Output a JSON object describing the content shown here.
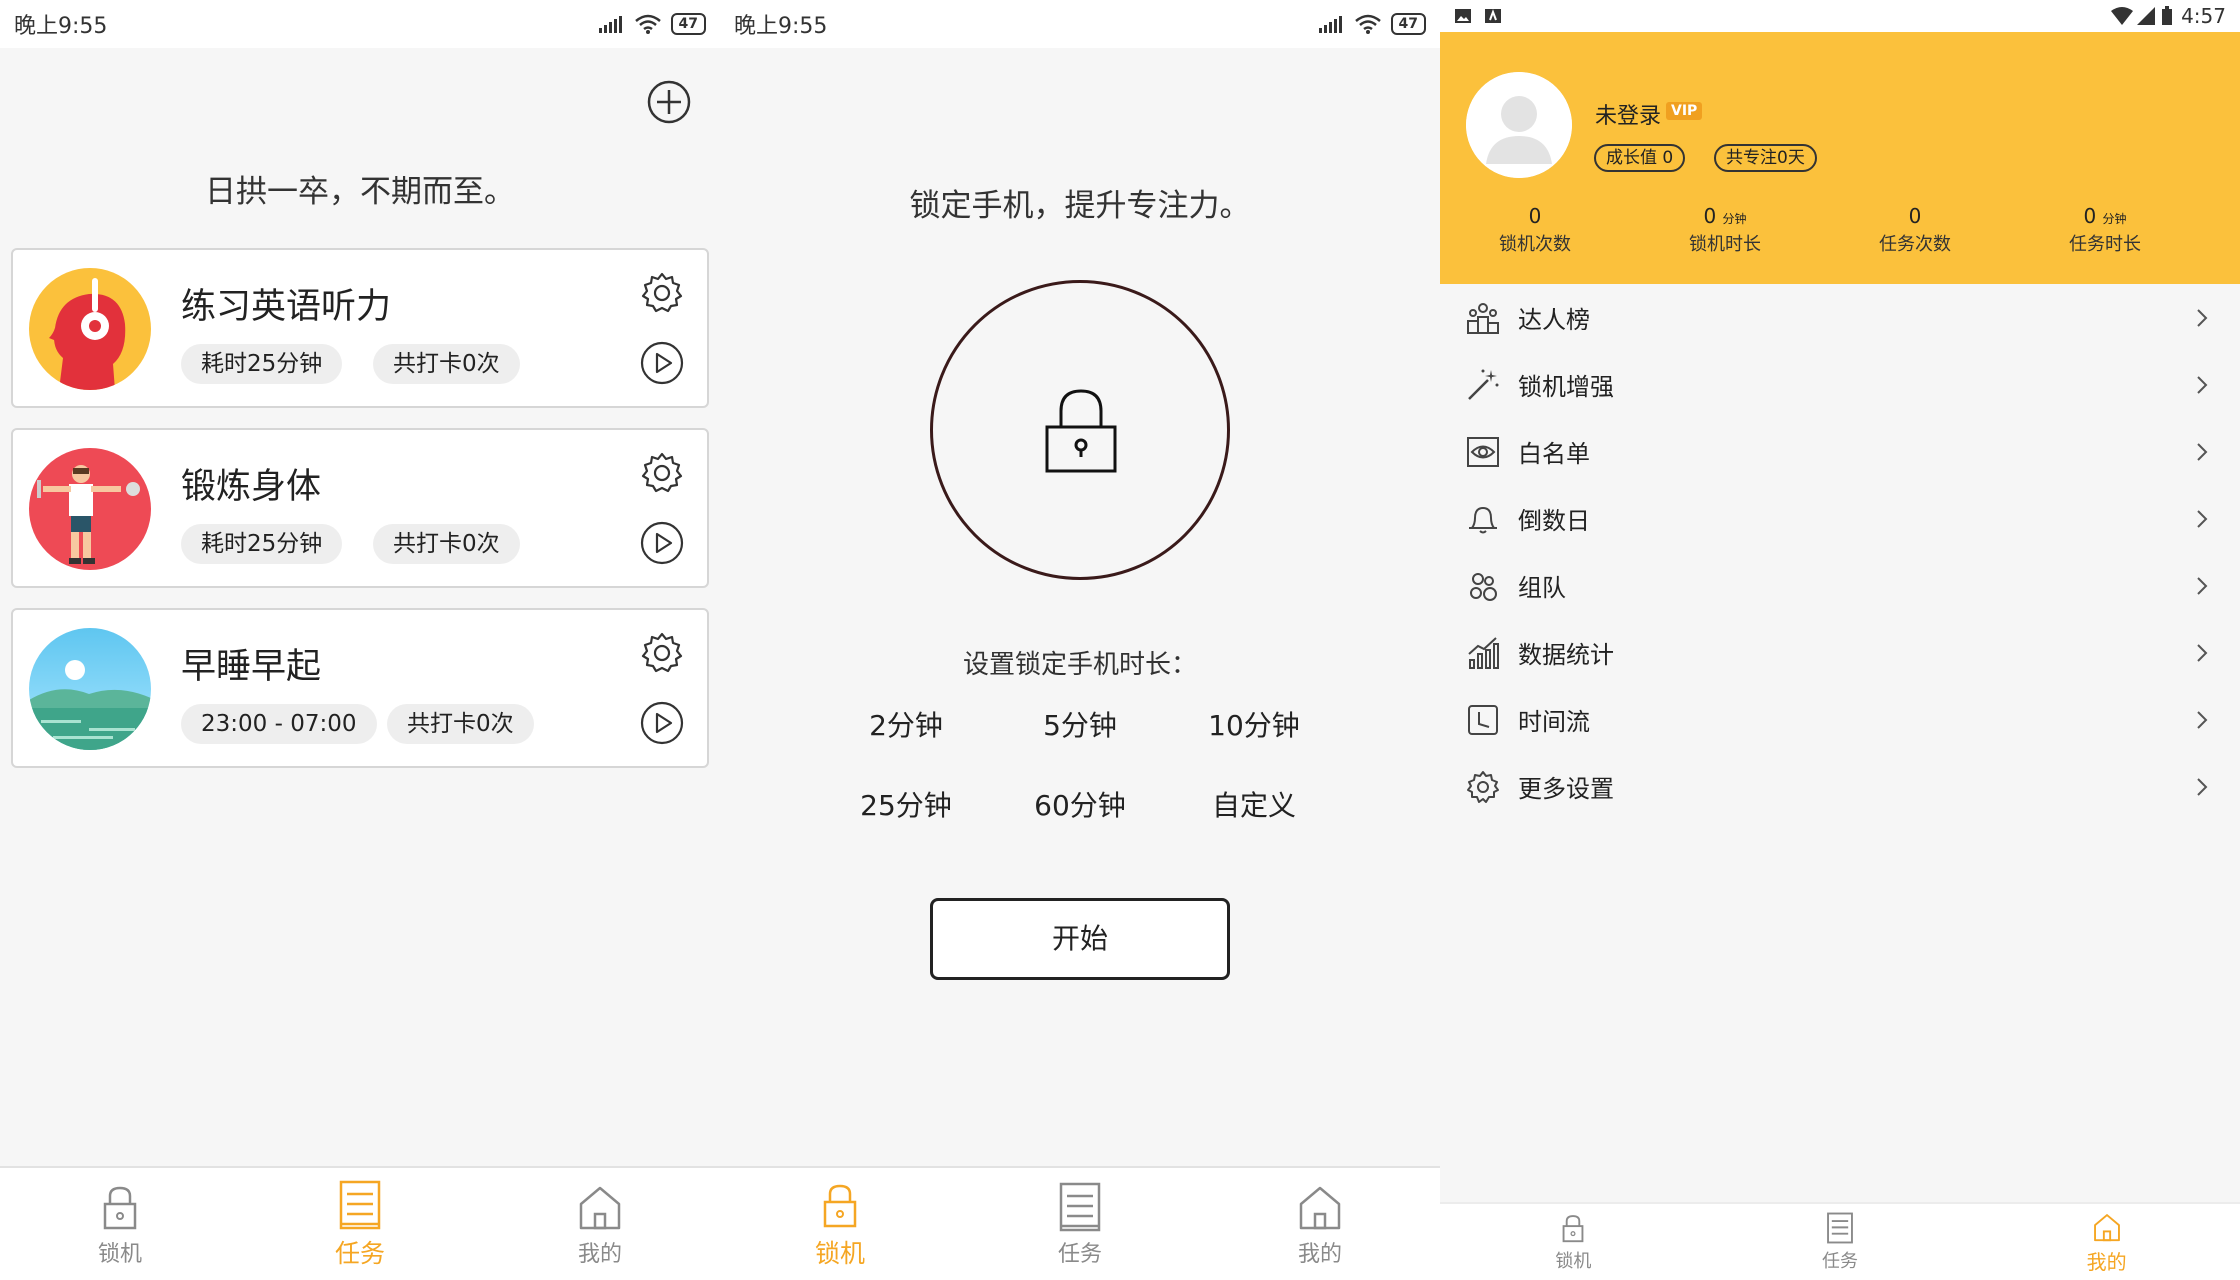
{
  "screen1": {
    "status_time": "晚上9:55",
    "battery": "47",
    "slogan": "日拱一卒，不期而至。",
    "tasks": [
      {
        "title": "练习英语听力",
        "pill1": "耗时25分钟",
        "pill2": "共打卡0次"
      },
      {
        "title": "锻炼身体",
        "pill1": "耗时25分钟",
        "pill2": "共打卡0次"
      },
      {
        "title": "早睡早起",
        "pill1": "23:00 - 07:00",
        "pill2": "共打卡0次"
      }
    ],
    "nav": [
      {
        "label": "锁机"
      },
      {
        "label": "任务"
      },
      {
        "label": "我的"
      }
    ]
  },
  "screen2": {
    "status_time": "晚上9:55",
    "battery": "47",
    "slogan": "锁定手机，提升专注力。",
    "duration_label": "设置锁定手机时长：",
    "options": [
      "2分钟",
      "5分钟",
      "10分钟",
      "25分钟",
      "60分钟",
      "自定义"
    ],
    "start": "开始",
    "nav": [
      {
        "label": "锁机"
      },
      {
        "label": "任务"
      },
      {
        "label": "我的"
      }
    ]
  },
  "screen3": {
    "status_time": "4:57",
    "username": "未登录",
    "vip": "VIP",
    "growth": "成长值 0",
    "focus_days": "共专注0天",
    "stats": [
      {
        "num": "0",
        "unit": "",
        "label": "锁机次数"
      },
      {
        "num": "0",
        "unit": "分钟",
        "label": "锁机时长"
      },
      {
        "num": "0",
        "unit": "",
        "label": "任务次数"
      },
      {
        "num": "0",
        "unit": "分钟",
        "label": "任务时长"
      }
    ],
    "menu": [
      {
        "label": "达人榜",
        "icon": "ranking-icon"
      },
      {
        "label": "锁机增强",
        "icon": "magic-wand-icon"
      },
      {
        "label": "白名单",
        "icon": "eye-icon"
      },
      {
        "label": "倒数日",
        "icon": "bell-icon"
      },
      {
        "label": "组队",
        "icon": "team-icon"
      },
      {
        "label": "数据统计",
        "icon": "chart-icon"
      },
      {
        "label": "时间流",
        "icon": "clock-icon"
      },
      {
        "label": "更多设置",
        "icon": "gear-icon"
      }
    ],
    "nav": [
      {
        "label": "锁机"
      },
      {
        "label": "任务"
      },
      {
        "label": "我的"
      }
    ]
  },
  "colors": {
    "accent": "#f5a623",
    "header": "#fbc13c"
  }
}
